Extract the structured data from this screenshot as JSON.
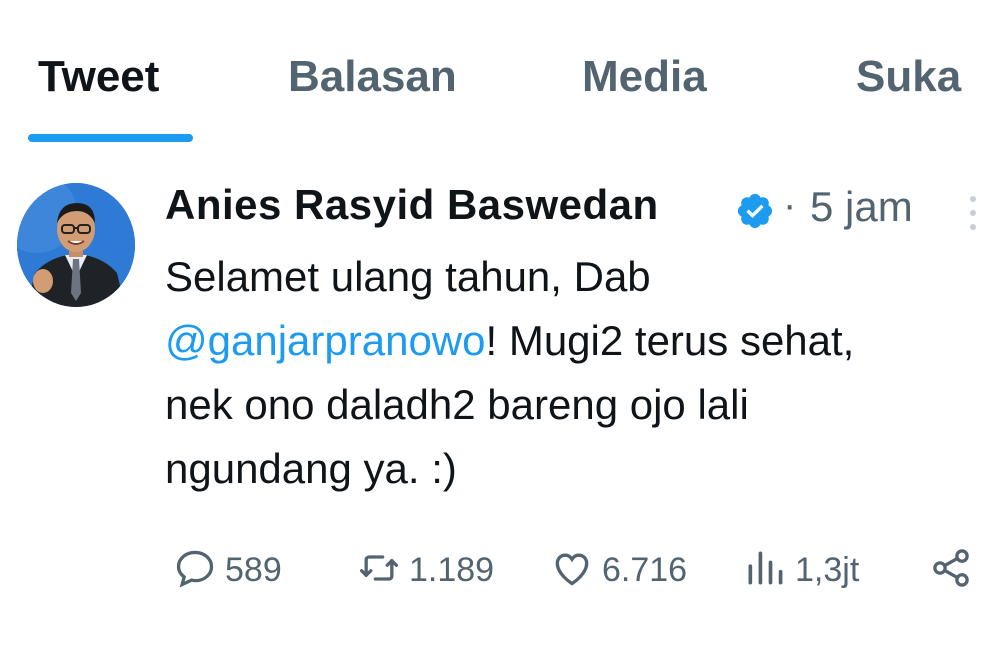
{
  "tabs": [
    {
      "label": "Tweet",
      "active": true
    },
    {
      "label": "Balasan",
      "active": false
    },
    {
      "label": "Media",
      "active": false
    },
    {
      "label": "Suka",
      "active": false
    }
  ],
  "accent_color": "#1d9bf0",
  "tweet": {
    "author_name": "Anies Rasyid Baswedan",
    "verified": true,
    "separator": "·",
    "time": "5 jam",
    "text_line1": "Selamet ulang tahun, Dab",
    "mention": "@ganjarpranowo",
    "text_after_mention": "! Mugi2 terus sehat,",
    "text_line3": "nek ono daladh2 bareng ojo lali",
    "text_line4": "ngundang ya. :)"
  },
  "actions": {
    "replies": {
      "icon": "reply-icon",
      "count": "589"
    },
    "retweets": {
      "icon": "retweet-icon",
      "count": "1.189"
    },
    "likes": {
      "icon": "heart-icon",
      "count": "6.716"
    },
    "views": {
      "icon": "views-icon",
      "count": "1,3jt"
    },
    "share": {
      "icon": "share-icon"
    }
  }
}
